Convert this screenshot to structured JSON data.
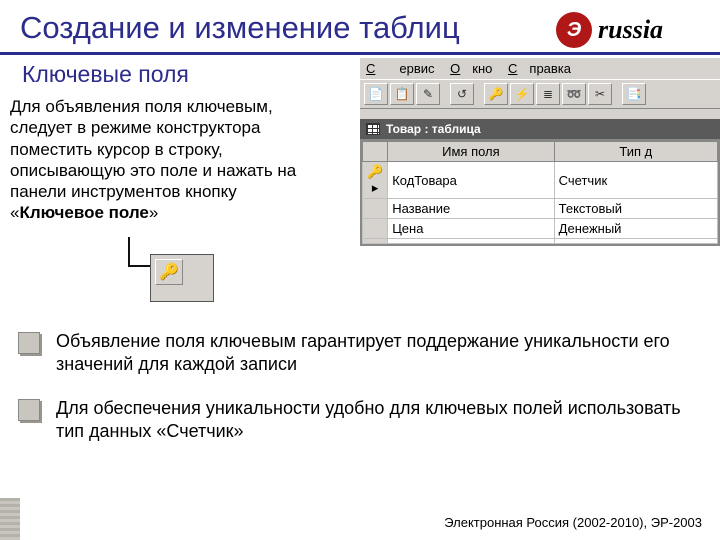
{
  "logo_text": "russia",
  "title": "Создание и изменение таблиц",
  "subtitle": "Ключевые поля",
  "body_text_pre": "Для объявления поля ключевым, следует в режиме конструктора поместить курсор в строку, описывающую это поле и нажать на панели инструментов кнопку «",
  "body_text_bold": "Ключевое поле",
  "body_text_post": "»",
  "access": {
    "menu": {
      "servis": "Сервис",
      "okno": "Окно",
      "spravka": "Справка"
    },
    "subwindow_title": "Товар : таблица",
    "headers": {
      "fieldname": "Имя поля",
      "datatype": "Тип д"
    },
    "rows": [
      {
        "name": "КодТовара",
        "type": "Счетчик",
        "key": true
      },
      {
        "name": "Название",
        "type": "Текстовый",
        "key": false
      },
      {
        "name": "Цена",
        "type": "Денежный",
        "key": false
      }
    ]
  },
  "bullets": [
    "Объявление поля ключевым гарантирует поддержание уникальности его значений для каждой записи",
    "Для обеспечения уникальности удобно для ключевых полей использовать тип данных «Счетчик»"
  ],
  "footer": "Электронная Россия (2002-2010), ЭР-2003"
}
